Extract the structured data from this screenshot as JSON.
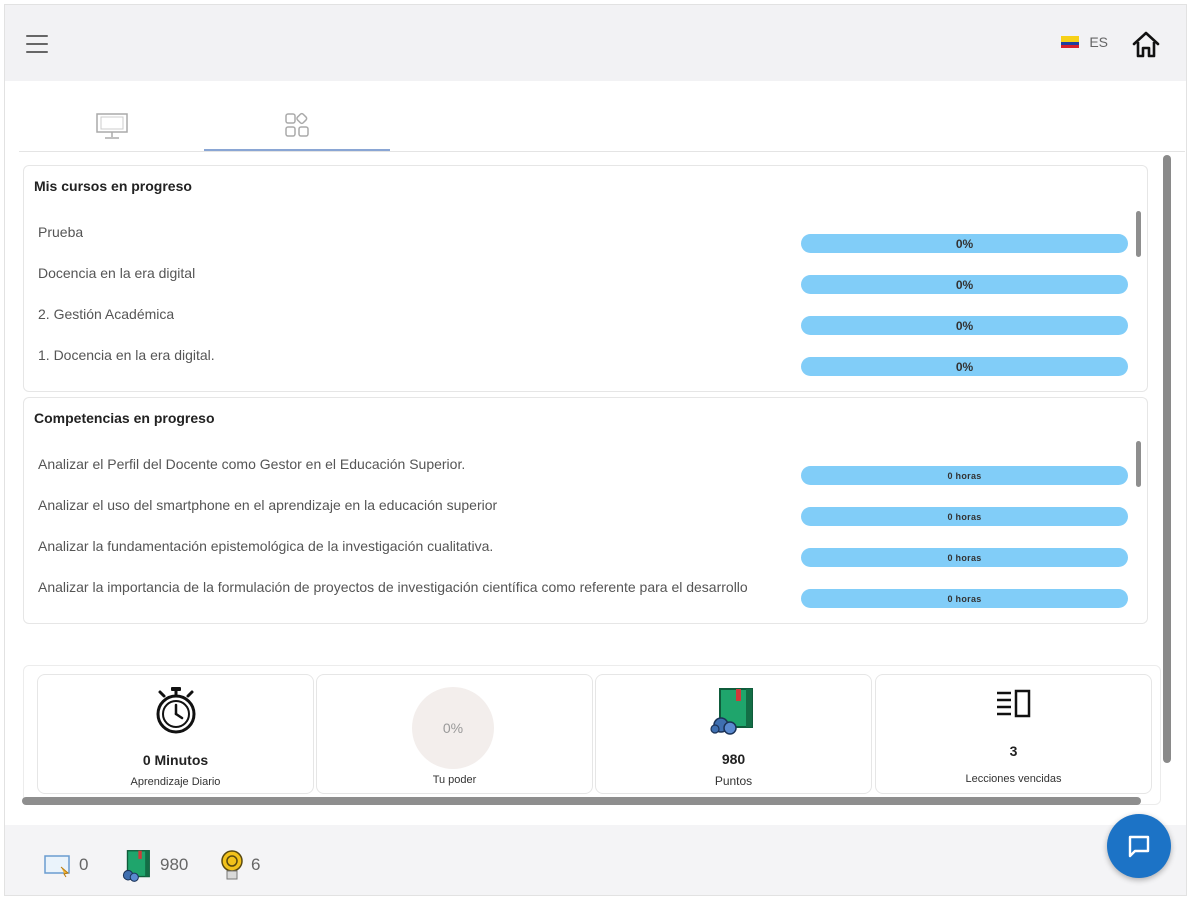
{
  "header": {
    "language": "ES"
  },
  "courses": {
    "title": "Mis cursos en progreso",
    "items": [
      {
        "label": "Prueba",
        "progress": "0%",
        "progress_value": 0
      },
      {
        "label": "Docencia en la era digital",
        "progress": "0%",
        "progress_value": 0
      },
      {
        "label": "2. Gestión Académica",
        "progress": "0%",
        "progress_value": 0
      },
      {
        "label": "1. Docencia en la era digital.",
        "progress": "0%",
        "progress_value": 0
      }
    ]
  },
  "competencies": {
    "title": "Competencias en progreso",
    "items": [
      {
        "label": "Analizar el Perfil del Docente como Gestor en el Educación Superior.",
        "progress": "0 horas",
        "progress_value": 0
      },
      {
        "label": "Analizar el uso del smartphone en el aprendizaje en la educación superior",
        "progress": "0 horas",
        "progress_value": 0
      },
      {
        "label": "Analizar la fundamentación epistemológica de la investigación cualitativa.",
        "progress": "0 horas",
        "progress_value": 0
      },
      {
        "label": "Analizar la importancia de la formulación de proyectos de investigación científica como referente para el desarrollo",
        "progress": "0 horas",
        "progress_value": 0
      }
    ]
  },
  "stats": {
    "daily": {
      "value": "0 Minutos",
      "label": "Aprendizaje Diario"
    },
    "power": {
      "value": "0%",
      "label": "Tu poder"
    },
    "points": {
      "value": "980",
      "label": "Puntos"
    },
    "lessons": {
      "value": "3",
      "label": "Lecciones vencidas"
    }
  },
  "footer": {
    "presentations": "0",
    "points": "980",
    "medals": "6"
  },
  "colors": {
    "accent": "#1c73c6",
    "progress_track": "#81cdf8",
    "tab_indicator": "#8aa6d4"
  }
}
